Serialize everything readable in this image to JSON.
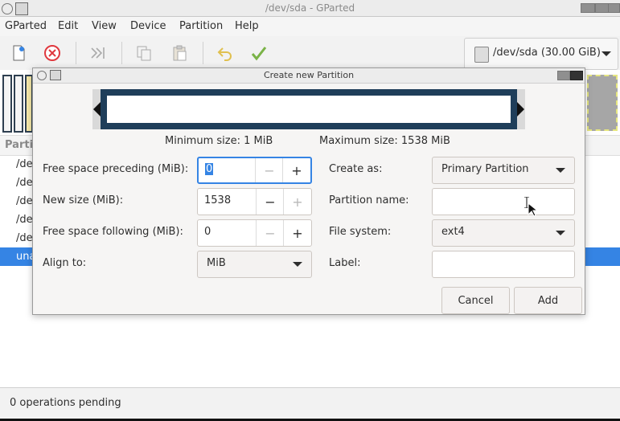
{
  "window": {
    "title": "/dev/sda - GParted"
  },
  "menubar": {
    "items": [
      "GParted",
      "Edit",
      "View",
      "Device",
      "Partition",
      "Help"
    ]
  },
  "toolbar": {
    "icons": [
      "new-icon",
      "delete-icon",
      "resize-move-icon",
      "copy-icon",
      "paste-icon",
      "undo-icon",
      "apply-icon"
    ],
    "device": "/dev/sda (30.00 GiB)"
  },
  "partition_list": {
    "header": "Parti",
    "rows": [
      "/de",
      "/de",
      "/de",
      "/de",
      "/de",
      "una"
    ]
  },
  "status": {
    "text": "0 operations pending"
  },
  "dialog": {
    "title": "Create new Partition",
    "min_size": "Minimum size: 1 MiB",
    "max_size": "Maximum size: 1538 MiB",
    "fields": {
      "free_preceding": {
        "label": "Free space preceding (MiB):",
        "value": "0"
      },
      "new_size": {
        "label": "New size (MiB):",
        "value": "1538"
      },
      "free_following": {
        "label": "Free space following (MiB):",
        "value": "0"
      },
      "align_to": {
        "label": "Align to:",
        "value": "MiB"
      },
      "create_as": {
        "label": "Create as:",
        "value": "Primary Partition"
      },
      "partition_name": {
        "label": "Partition name:",
        "value": ""
      },
      "file_system": {
        "label": "File system:",
        "value": "ext4"
      },
      "label": {
        "label": "Label:",
        "value": ""
      }
    },
    "buttons": {
      "cancel": "Cancel",
      "add": "Add"
    }
  },
  "colors": {
    "accent": "#3584e4",
    "partition_frame": "#1f3e5a"
  }
}
